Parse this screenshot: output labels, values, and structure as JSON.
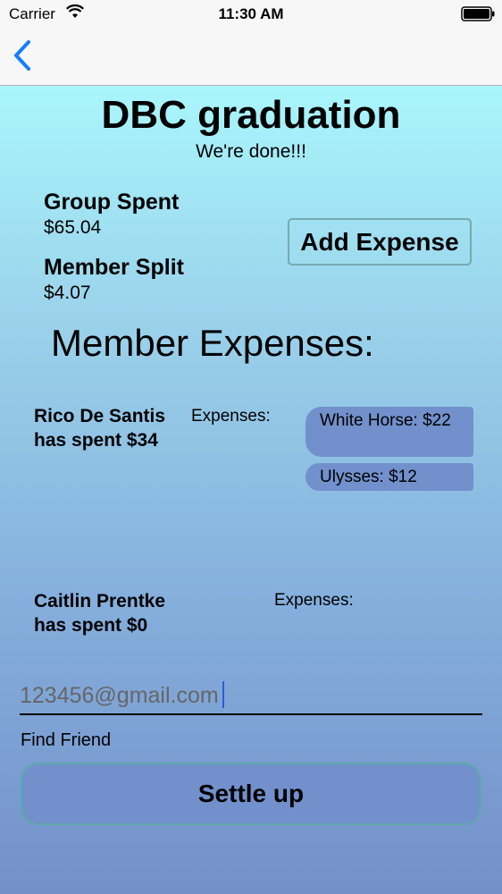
{
  "status_bar": {
    "carrier": "Carrier",
    "time": "11:30 AM"
  },
  "nav": {
    "back_icon": "chevron-left-icon"
  },
  "event": {
    "title": "DBC graduation",
    "subtitle": "We're done!!!"
  },
  "summary": {
    "group_spent_label": "Group Spent",
    "group_spent_value": "$65.04",
    "member_split_label": "Member Split",
    "member_split_value": "$4.07"
  },
  "actions": {
    "add_expense_label": "Add Expense",
    "settle_label": "Settle up"
  },
  "members_title": "Member Expenses:",
  "members": [
    {
      "summary": "Rico De Santis  has spent $34",
      "expenses_label": "Expenses:",
      "expenses": [
        "White Horse: $22",
        "Ulysses: $12"
      ]
    },
    {
      "summary": "Caitlin Prentke has spent $0",
      "expenses_label": "Expenses:",
      "expenses": []
    }
  ],
  "find_friend": {
    "input_value": "123456@gmail.com",
    "label": "Find Friend"
  },
  "colors": {
    "back_blue": "#147efb",
    "pill": "#7190cc",
    "button_border": "#5ca9a9"
  }
}
